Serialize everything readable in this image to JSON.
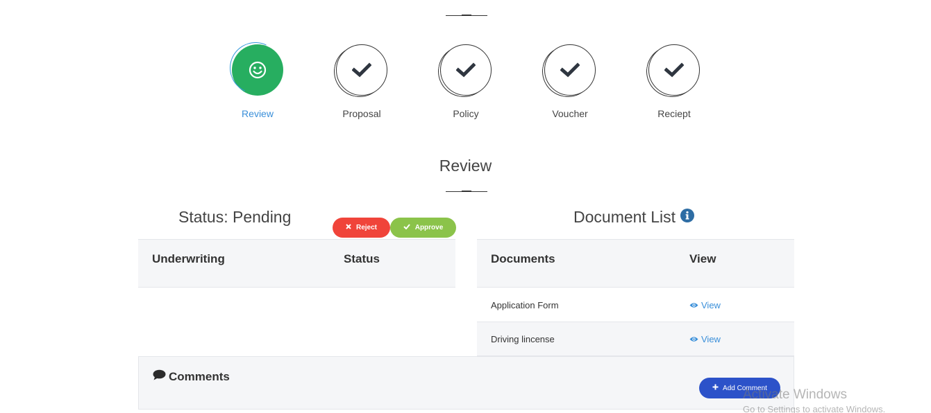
{
  "steps": [
    {
      "label": "Review",
      "icon": "smile-icon",
      "active": true
    },
    {
      "label": "Proposal",
      "icon": "check-icon",
      "active": false
    },
    {
      "label": "Policy",
      "icon": "check-icon",
      "active": false
    },
    {
      "label": "Voucher",
      "icon": "check-icon",
      "active": false
    },
    {
      "label": "Reciept",
      "icon": "check-icon",
      "active": false
    }
  ],
  "section": {
    "title": "Review"
  },
  "status_panel": {
    "title": "Status: Pending",
    "reject_label": "Reject",
    "approve_label": "Approve",
    "columns": [
      "Underwriting",
      "Status"
    ]
  },
  "document_panel": {
    "title": "Document List",
    "columns": [
      "Documents",
      "View"
    ],
    "rows": [
      {
        "name": "Application Form",
        "link": "View"
      },
      {
        "name": "Driving lincense",
        "link": "View"
      }
    ]
  },
  "comments": {
    "title": "Comments",
    "add_label": "Add Comment"
  },
  "watermark": {
    "line1": "Activate Windows",
    "line2": "Go to Settings to activate Windows."
  },
  "colors": {
    "active_step": "#27ae60",
    "reject": "#f0443a",
    "approve": "#8bc34a",
    "link": "#3a8fd9",
    "add_comment": "#2c52c9"
  }
}
